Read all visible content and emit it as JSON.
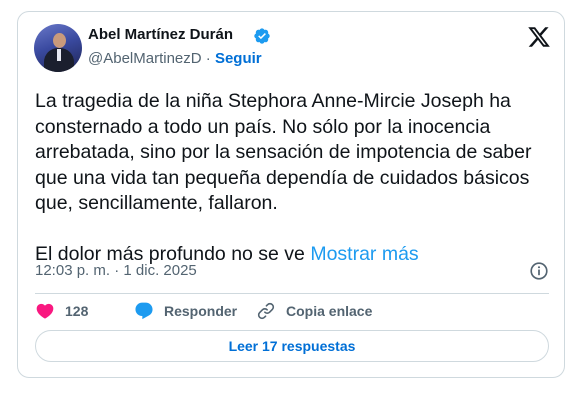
{
  "author": {
    "name": "Abel Martínez Durán",
    "handle": "@AbelMartinezD",
    "separator": "·",
    "follow_label": "Seguir"
  },
  "tweet": {
    "paragraph1": "La tragedia de la niña Stephora Anne-Mircie Joseph ha consternado a todo un país. No sólo por la inocencia arrebatada, sino por la sensación de impotencia de saber que una vida tan pequeña dependía de cuidados básicos que, sencillamente, fallaron.",
    "paragraph2": "El dolor más profundo no se ve",
    "show_more": "Mostrar más"
  },
  "meta": {
    "time": "12:03 p. m.",
    "separator": "·",
    "date": "1 dic. 2025"
  },
  "actions": {
    "like_count": "128",
    "reply_label": "Responder",
    "copy_link_label": "Copia enlace"
  },
  "replies_button": "Leer 17 respuestas",
  "colors": {
    "like": "#f91880",
    "reply": "#1d9bf0",
    "link": "#006fd6",
    "show_more": "#1d9bf0",
    "verified": "#1d9bf0"
  },
  "icons": {
    "avatar": "avatar",
    "verified": "verified-badge-icon",
    "brand": "x-logo-icon",
    "info": "info-icon",
    "like": "heart-icon",
    "reply": "speech-bubble-icon",
    "copy": "link-icon"
  }
}
